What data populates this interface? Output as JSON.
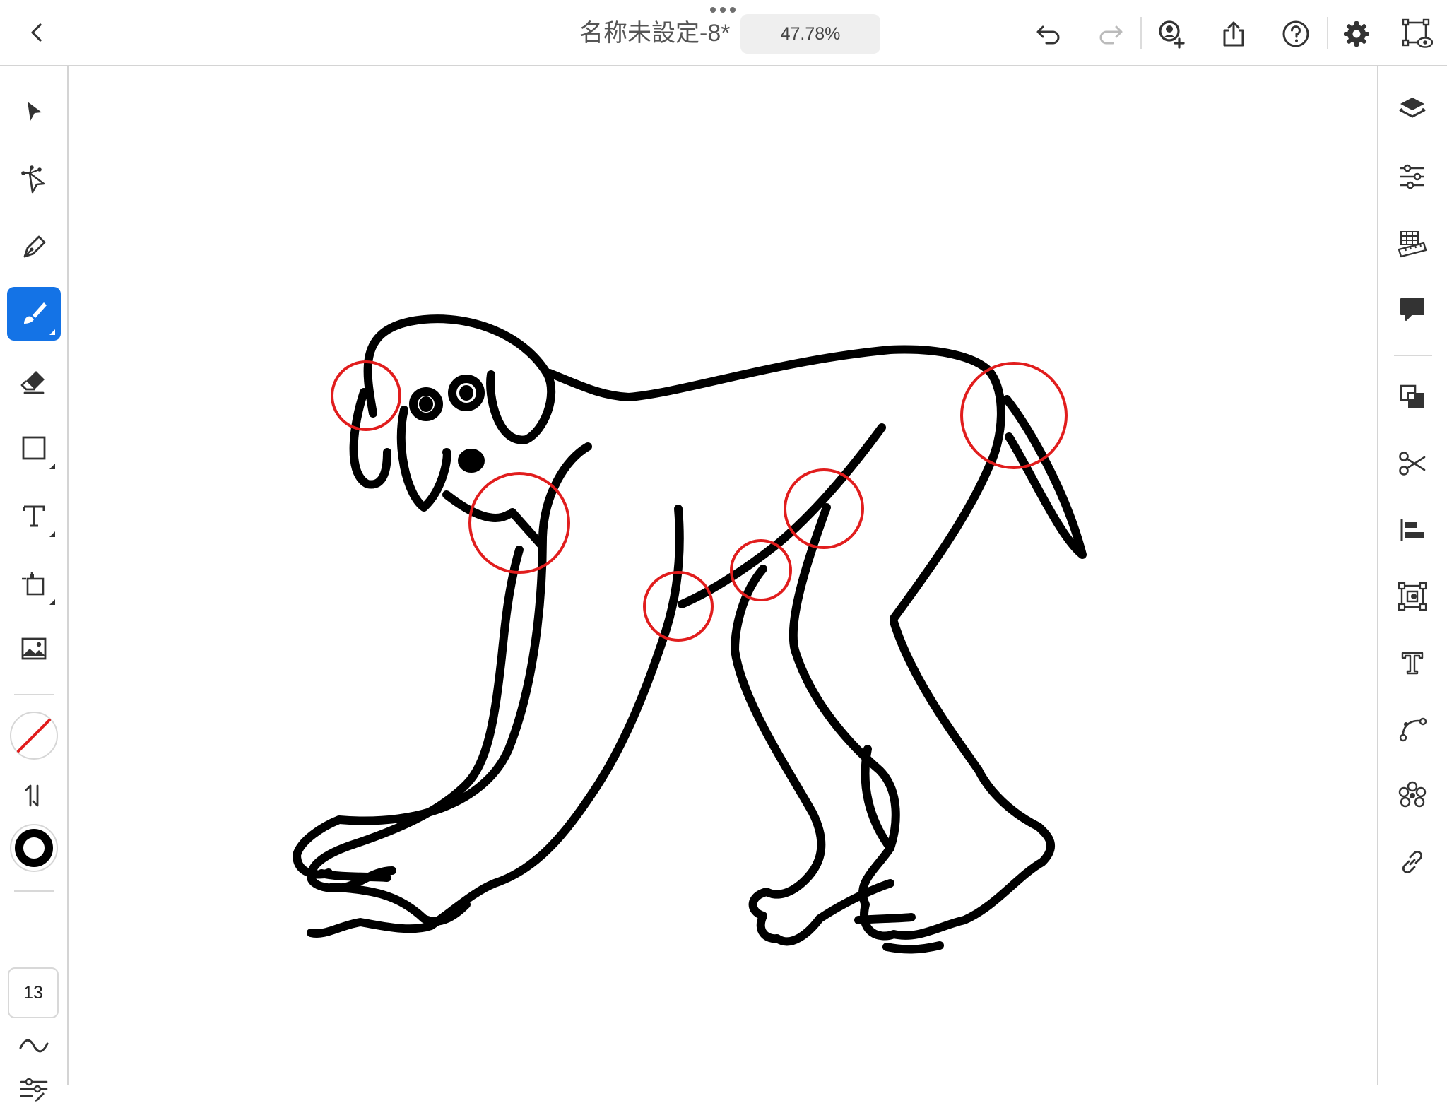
{
  "document": {
    "title": "名称未設定-8*",
    "zoom": "47.78%"
  },
  "top_toolbar": {
    "items": [
      "back-icon",
      "more-options-icon",
      "undo-icon",
      "redo-icon",
      "invite-icon",
      "share-icon",
      "help-icon",
      "settings-icon",
      "preview-icon"
    ]
  },
  "left_toolbar": {
    "tools": [
      "selection-tool-icon",
      "direct-selection-tool-icon",
      "pen-tool-icon",
      "pencil-brush-tool-icon",
      "eraser-tool-icon",
      "rectangle-tool-icon",
      "type-tool-icon",
      "transform-tool-icon",
      "place-image-icon"
    ],
    "active_tool": "pencil-brush-tool-icon",
    "fill_swatch": "none",
    "stroke_swatch": "#000000",
    "stroke_width": "13"
  },
  "right_panel": {
    "items": [
      "layers-icon",
      "properties-icon",
      "grid-rulers-icon",
      "comments-icon",
      "arrange-icon",
      "path-operations-icon",
      "align-icon",
      "crop-mask-icon",
      "type-options-icon",
      "path-tools-icon",
      "repeat-icon",
      "links-icon"
    ]
  },
  "colors": {
    "accent": "#1473e6",
    "stroke": "#000000",
    "annotation": "#e11d1d"
  }
}
